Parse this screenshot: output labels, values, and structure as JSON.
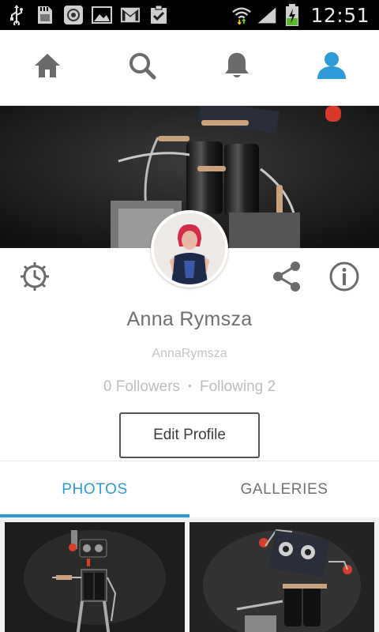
{
  "status_bar": {
    "time": "12:51",
    "icons": [
      "usb-icon",
      "sd-card-icon",
      "sync-icon",
      "image-icon",
      "gmail-icon",
      "clipboard-check-icon",
      "wifi-icon",
      "signal-icon",
      "battery-charging-icon"
    ]
  },
  "nav": {
    "items": [
      {
        "name": "home",
        "icon": "home-icon",
        "active": false
      },
      {
        "name": "search",
        "icon": "search-icon",
        "active": false
      },
      {
        "name": "notifications",
        "icon": "bell-icon",
        "active": false
      },
      {
        "name": "profile",
        "icon": "user-icon",
        "active": true
      }
    ],
    "active_color": "#2d9bd6",
    "inactive_color": "#6b6b6b"
  },
  "profile": {
    "name": "Anna Rymsza",
    "username": "AnnaRymsza",
    "followers_text": "0 Followers",
    "separator": "•",
    "following_text": "Following 2",
    "edit_button_label": "Edit Profile"
  },
  "tabs": [
    {
      "label": "PHOTOS",
      "active": true
    },
    {
      "label": "GALLERIES",
      "active": false
    }
  ],
  "colors": {
    "accent": "#2d9bd6",
    "text_primary": "#6f6f6f",
    "text_muted": "#bdbdbd"
  }
}
